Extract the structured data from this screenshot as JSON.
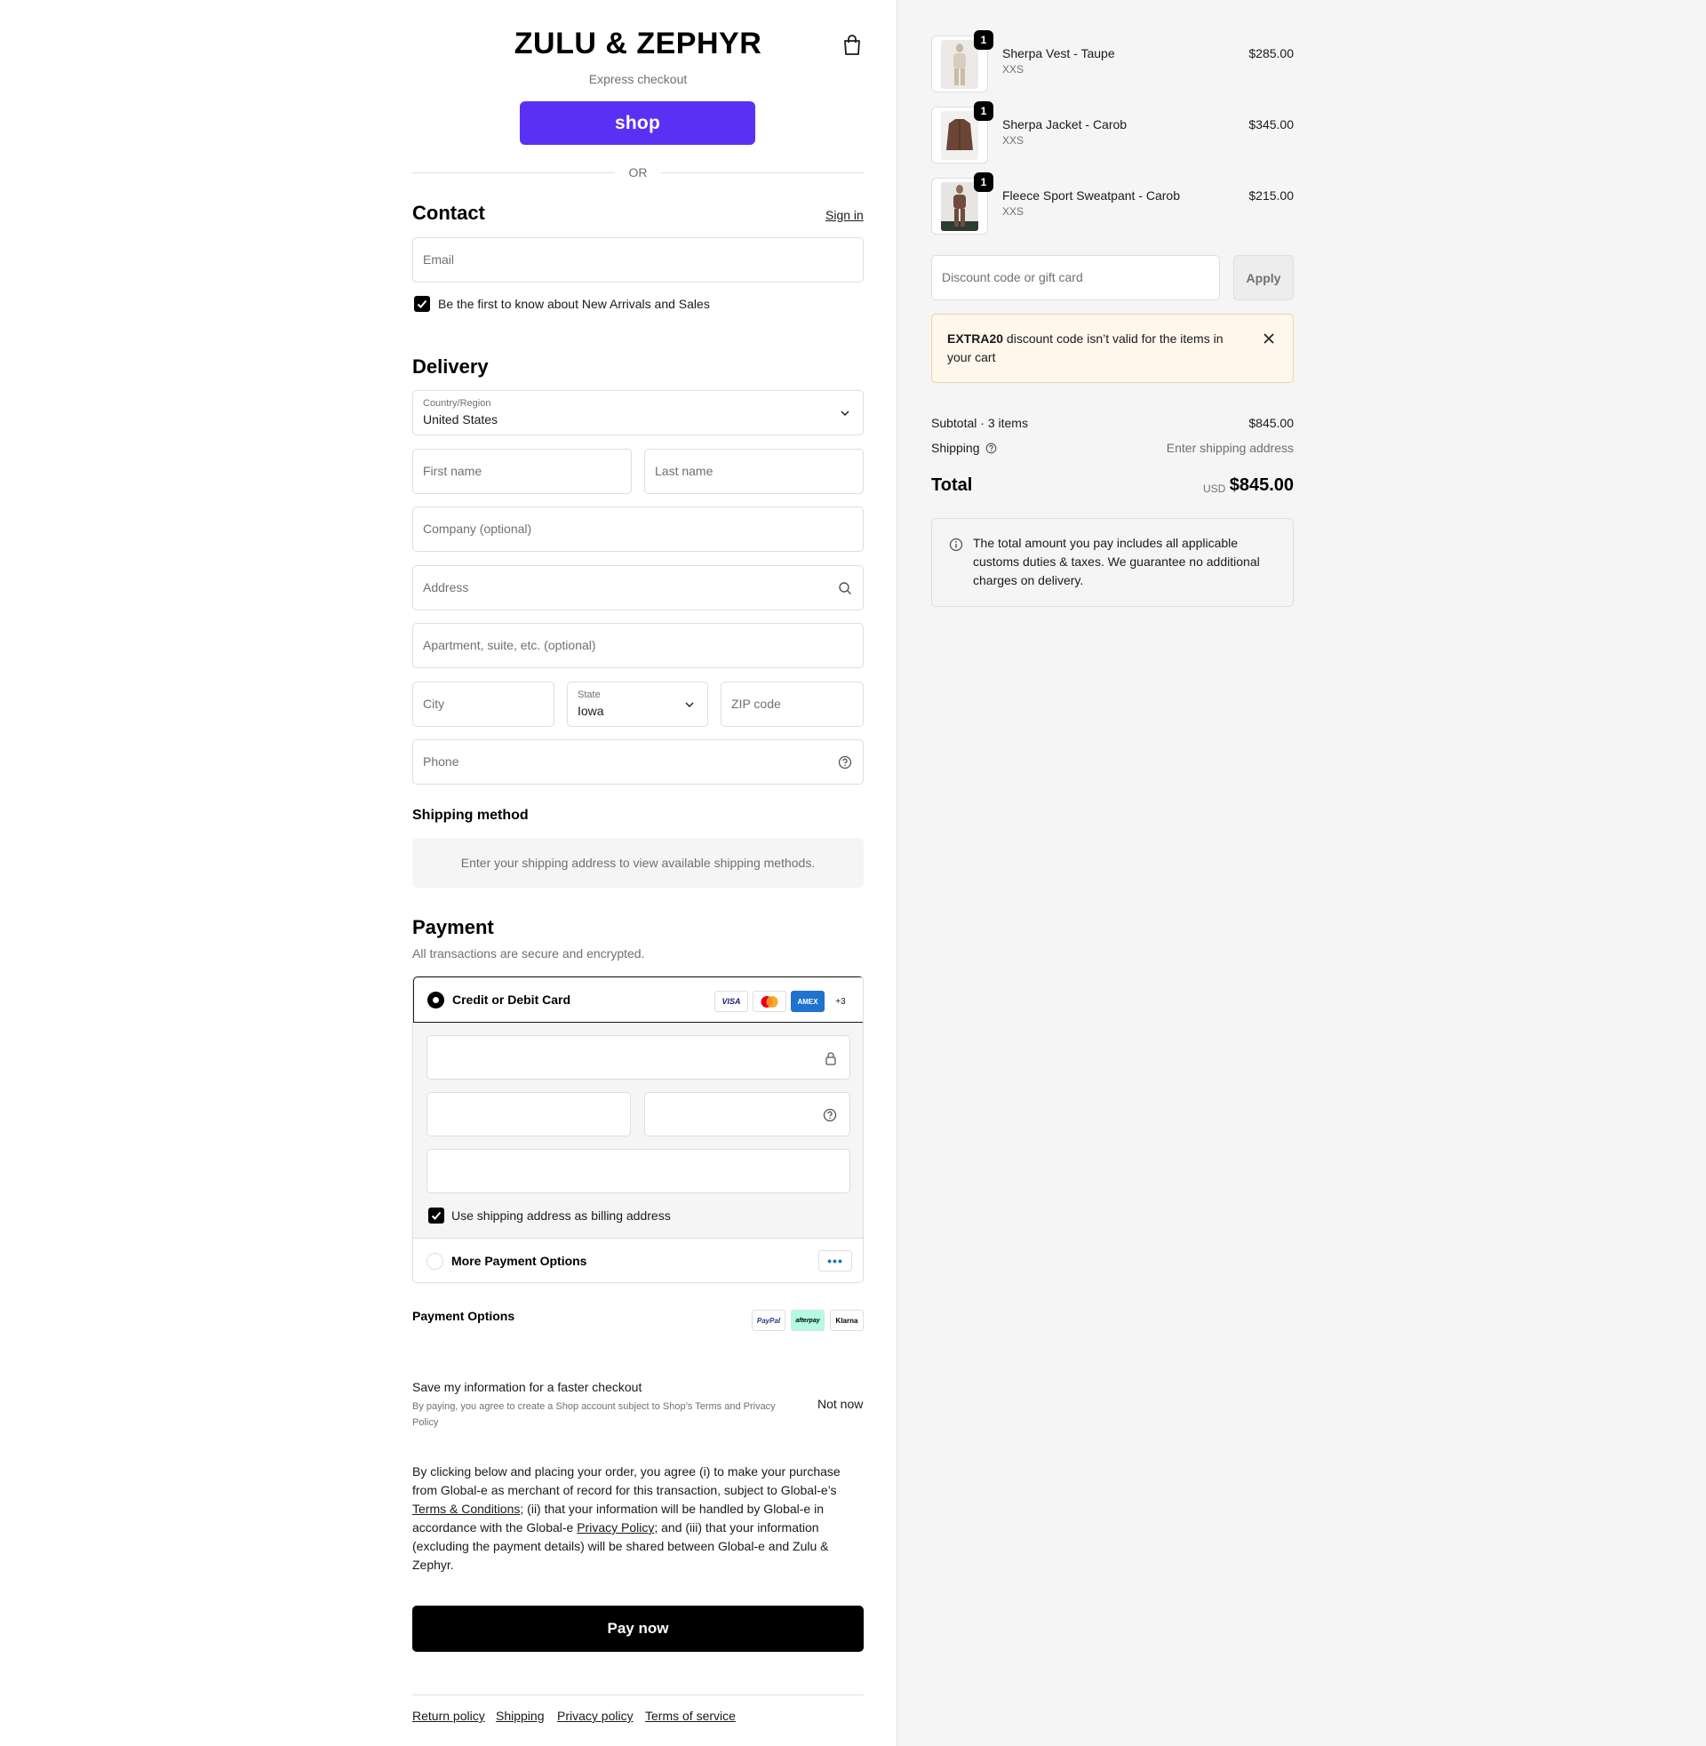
{
  "header": {
    "brand": "ZULU & ZEPHYR",
    "express_checkout": "Express checkout",
    "shop_button": "shop",
    "or": "OR"
  },
  "contact": {
    "title": "Contact",
    "sign_in": "Sign in",
    "email_placeholder": "Email",
    "newsletter_label": "Be the first to know about New Arrivals and Sales",
    "newsletter_checked": true
  },
  "delivery": {
    "title": "Delivery",
    "country_label": "Country/Region",
    "country_value": "United States",
    "first_name": "First name",
    "last_name": "Last name",
    "company": "Company (optional)",
    "address": "Address",
    "apartment": "Apartment, suite, etc. (optional)",
    "city": "City",
    "state_label": "State",
    "state_value": "Iowa",
    "zip": "ZIP code",
    "phone": "Phone"
  },
  "shipping": {
    "title": "Shipping method",
    "message": "Enter your shipping address to view available shipping methods."
  },
  "payment": {
    "title": "Payment",
    "subtitle": "All transactions are secure and encrypted.",
    "card_option": "Credit or Debit Card",
    "card_brands": [
      "VISA",
      "MC",
      "AMEX",
      "+3"
    ],
    "billing_label": "Use shipping address as billing address",
    "billing_checked": true,
    "more_options": "More Payment Options",
    "options_title": "Payment Options",
    "options_brands": [
      "PayPal",
      "afterpay",
      "Klarna"
    ]
  },
  "save_info": {
    "title": "Save my information for a faster checkout",
    "fine_prefix": "By paying, you agree to create a Shop account subject to Shop’s ",
    "terms": "Terms",
    "and": " and ",
    "privacy": "Privacy Policy",
    "not_now": "Not now"
  },
  "legal": {
    "p1": "By clicking below and placing your order, you agree (i) to make your purchase from Global-e as merchant of record for this transaction, subject to Global-e’s ",
    "terms_link": "Terms & Conditions",
    "p2": "; (ii) that your information will be handled by Global-e in accordance with the Global-e ",
    "privacy_link": "Privacy Policy",
    "p3": "; and (iii) that your information (excluding the payment details) will be shared between Global-e and Zulu & Zephyr."
  },
  "pay_now": "Pay now",
  "footer": {
    "links": [
      "Return policy",
      "Shipping",
      "Privacy policy",
      "Terms of service"
    ]
  },
  "cart": {
    "items": [
      {
        "name": "Sherpa Vest - Taupe",
        "variant": "XXS",
        "price": "$285.00",
        "qty": "1"
      },
      {
        "name": "Sherpa Jacket - Carob",
        "variant": "XXS",
        "price": "$345.00",
        "qty": "1"
      },
      {
        "name": "Fleece Sport Sweatpant - Carob",
        "variant": "XXS",
        "price": "$215.00",
        "qty": "1"
      }
    ],
    "discount_placeholder": "Discount code or gift card",
    "apply": "Apply",
    "alert_code": "EXTRA20",
    "alert_msg": " discount code isn’t valid for the items in your cart",
    "subtotal_label": "Subtotal · 3 items",
    "subtotal_value": "$845.00",
    "shipping_label": "Shipping",
    "shipping_value": "Enter shipping address",
    "total_label": "Total",
    "currency": "USD",
    "total_value": "$845.00",
    "info": "The total amount you pay includes all applicable customs duties & taxes. We guarantee no additional charges on delivery."
  },
  "colors": {
    "shop_purple": "#5a31f4",
    "amex_blue": "#1f72cd",
    "alert_bg": "#fff6ec",
    "link_blue": "#1773b0"
  }
}
